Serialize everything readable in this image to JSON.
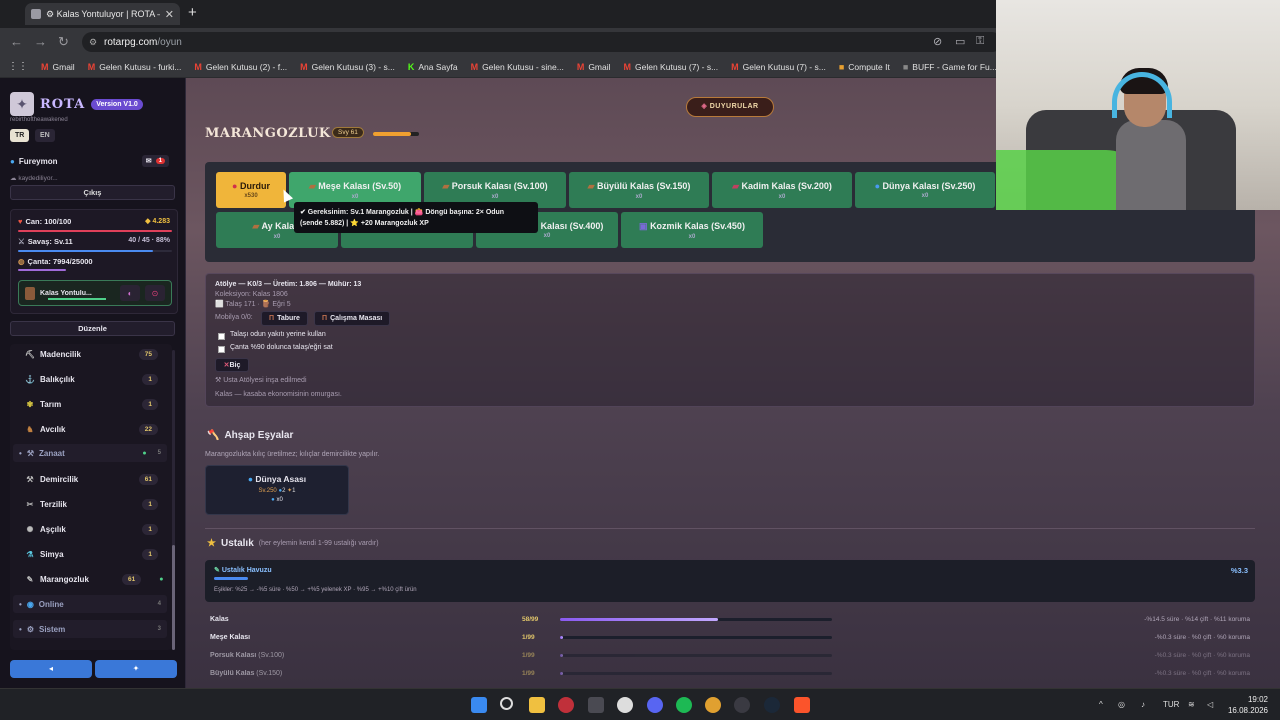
{
  "browser": {
    "tab_title": "⚙ Kalas Yontuluyor | ROTA —",
    "url_host": "rotarpg.com",
    "url_path": "/oyun",
    "bookmarks": [
      {
        "label": "Gmail",
        "mark": "M",
        "color": "#ea4335"
      },
      {
        "label": "Gelen Kutusu - furki...",
        "mark": "M",
        "color": "#ea4335"
      },
      {
        "label": "Gelen Kutusu (2) - f...",
        "mark": "M",
        "color": "#ea4335"
      },
      {
        "label": "Gelen Kutusu (3) - s...",
        "mark": "M",
        "color": "#ea4335"
      },
      {
        "label": "Ana Sayfa",
        "mark": "K",
        "color": "#53fc18"
      },
      {
        "label": "Gelen Kutusu - sine...",
        "mark": "M",
        "color": "#ea4335"
      },
      {
        "label": "Gmail",
        "mark": "M",
        "color": "#ea4335"
      },
      {
        "label": "Gelen Kutusu (7) - s...",
        "mark": "M",
        "color": "#ea4335"
      },
      {
        "label": "Gelen Kutusu (7) - s...",
        "mark": "M",
        "color": "#ea4335"
      },
      {
        "label": "Compute It",
        "mark": "■",
        "color": "#e8a030"
      },
      {
        "label": "BUFF - Game for Fu...",
        "mark": "■",
        "color": "#888888"
      },
      {
        "label": "Ç",
        "mark": "■",
        "color": "#4a8ae0"
      }
    ]
  },
  "sidebar": {
    "app_name": "ROTA",
    "version": "Version V1.0",
    "tagline": "rebirthoftheawakened",
    "lang_tr": "TR",
    "lang_en": "EN",
    "username": "Fureymon",
    "notif_count": "1",
    "saved_text": "kaydediliyor...",
    "logout": "Çıkış",
    "hp_label": "Can: 100/100",
    "gold": "4.283",
    "combat_label": "Savaş: Sv.11",
    "combat_xp": "40 / 45 · 88%",
    "bag_label": "Çanta: 7994/25000",
    "activity_name": "Kalas Yontulu...",
    "edit": "Düzenle",
    "skills": [
      {
        "icon": "⛏",
        "name": "Madencilik",
        "level": "75"
      },
      {
        "icon": "🎣",
        "name": "Balıkçılık",
        "level": "1"
      },
      {
        "icon": "🌾",
        "name": "Tarım",
        "level": "1"
      },
      {
        "icon": "🦌",
        "name": "Avcılık",
        "level": "22"
      }
    ],
    "group_craft": "Zanaat",
    "group_craft_count": "5",
    "craft_skills": [
      {
        "icon": "⚒",
        "name": "Demircilik",
        "level": "61"
      },
      {
        "icon": "✂",
        "name": "Terzilik",
        "level": "1"
      },
      {
        "icon": "🍳",
        "name": "Aşçılık",
        "level": "1"
      },
      {
        "icon": "⚗",
        "name": "Simya",
        "level": "1"
      },
      {
        "icon": "🪚",
        "name": "Marangozluk",
        "level": "61"
      }
    ],
    "group_online": "Online",
    "group_online_count": "4",
    "group_system": "Sistem",
    "group_system_count": "3",
    "btn_left": "◂",
    "btn_right": "✦"
  },
  "main": {
    "announcements": "Duyurular",
    "title": "Marangozluk",
    "level_badge": "Svy 61",
    "nodes_row1": [
      {
        "name": "Durdur",
        "sub": "x530",
        "state": "active"
      },
      {
        "name": "Meşe Kalası (Sv.50)",
        "sub": "x0",
        "state": "hl"
      },
      {
        "name": "Porsuk Kalası (Sv.100)",
        "sub": "x0",
        "state": ""
      },
      {
        "name": "Büyülü Kalas (Sv.150)",
        "sub": "x0",
        "state": ""
      },
      {
        "name": "Kadim Kalas (Sv.200)",
        "sub": "x0",
        "state": ""
      },
      {
        "name": "Dünya Kalası (Sv.250)",
        "sub": "x0",
        "state": ""
      }
    ],
    "nodes_row2": [
      {
        "name": "Ay Kalası",
        "sub": "x0"
      },
      {
        "name": "Kalası (Sv.400)",
        "sub": "x0"
      },
      {
        "name": "Kozmik Kalas (Sv.450)",
        "sub": "x0"
      }
    ],
    "tooltip_line1": "✔ Gereksinim: Sv.1 Marangozluk | 👛 Döngü başına: 2× Odun",
    "tooltip_line2": "(sende 5.882) | ⭐ +20 Marangozluk XP",
    "workshop": {
      "line1": "Atölye — K0/3 — Üretim: 1.806 — Mühür: 13",
      "line2": "Koleksiyon: Kalas 1806",
      "line3": "⬜ Talaş 171 · 🪵 Eğri 5",
      "furniture_label": "Mobilya 0/0:",
      "chip1": "Tabure",
      "chip2": "Çalışma Masası",
      "check1": "Talaşı odun yakıtı yerine kullan",
      "check2": "Çanta %90 dolunca talaş/eğri sat",
      "action": "Biç",
      "note1": "Usta Atölyesi inşa edilmedi",
      "note2": "Kalas — kasaba ekonomisinin omurgası."
    },
    "wood_title": "Ahşap Eşyalar",
    "wood_sub": "Marangozlukta kılıç üretilmez; kılıçlar demircilikte yapılır.",
    "item": {
      "name": "Dünya Asası",
      "lv": "Sv.250",
      "c1": "2",
      "c2": "1",
      "count": "x0"
    },
    "mastery_title": "Ustalık",
    "mastery_sub": "(her eylemin kendi 1-99 ustalığı vardır)",
    "pool_title": "Ustalık Havuzu",
    "pool_pct": "%3.3",
    "pool_fill": 0.033,
    "pool_thresholds": "Eşikler: %25 → -%5 süre · %50 → +%5 yelenek XP · %95 → +%10 çift ürün",
    "mastery_rows": [
      {
        "name": "Kalas",
        "extra": "",
        "count": "58/99",
        "fill": 0.58,
        "effect": "-%14.5 süre · %14 çift · %11 koruma",
        "dim": false
      },
      {
        "name": "Meşe Kalası",
        "extra": "",
        "count": "1/99",
        "fill": 0.01,
        "effect": "-%0.3 süre · %0 çift · %0 koruma",
        "dim": false
      },
      {
        "name": "Porsuk Kalası",
        "extra": " (Sv.100)",
        "count": "1/99",
        "fill": 0.01,
        "effect": "-%0.3 süre · %0 çift · %0 koruma",
        "dim": true
      },
      {
        "name": "Büyülü Kalas",
        "extra": " (Sv.150)",
        "count": "1/99",
        "fill": 0.01,
        "effect": "-%0.3 süre · %0 çift · %0 koruma",
        "dim": true
      }
    ]
  },
  "taskbar": {
    "lang": "TUR",
    "time": "19:02",
    "date": "16.08.2026"
  }
}
